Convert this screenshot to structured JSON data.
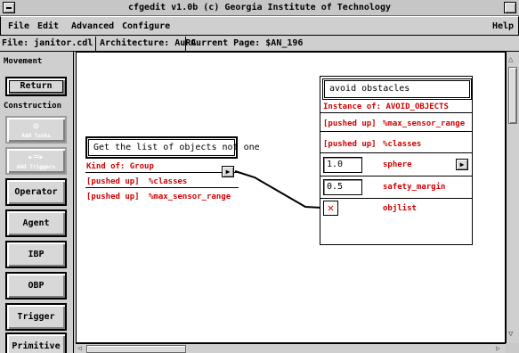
{
  "window": {
    "title": "cfgedit v1.0b  (c) Georgia Institute of Technology"
  },
  "menu": {
    "file": "File",
    "edit": "Edit",
    "advanced": "Advanced",
    "configure": "Configure",
    "help": "Help"
  },
  "info": {
    "file": "File:  janitor.cdl",
    "architecture": "Architecture: AuRA",
    "page": "Current Page:  $AN_196"
  },
  "palette": {
    "movement_label": "Movement",
    "construction_label": "Construction",
    "return": "Return",
    "add_tasks": "Add Tasks",
    "add_triggers": "Add Triggers",
    "operator": "Operator",
    "agent": "Agent",
    "ibp": "IBP",
    "obp": "OBP",
    "trigger": "Trigger",
    "primitive": "Primitive"
  },
  "node_group": {
    "name": "Get the list of objects not one",
    "kind": "Kind of: Group",
    "rows": [
      {
        "state": "[pushed up]",
        "param": "%classes"
      },
      {
        "state": "[pushed up]",
        "param": "%max_sensor_range"
      }
    ]
  },
  "node_avoid": {
    "name": "avoid obstacles",
    "instance": "Instance of: AVOID_OBJECTS",
    "rows": [
      {
        "state": "[pushed up]",
        "param": "%max_sensor_range"
      },
      {
        "state": "[pushed up]",
        "param": "%classes"
      }
    ],
    "sphere_value": "1.0",
    "sphere_label": "sphere",
    "margin_value": "0.5",
    "margin_label": "safety_margin",
    "objlist_label": "objlist"
  }
}
